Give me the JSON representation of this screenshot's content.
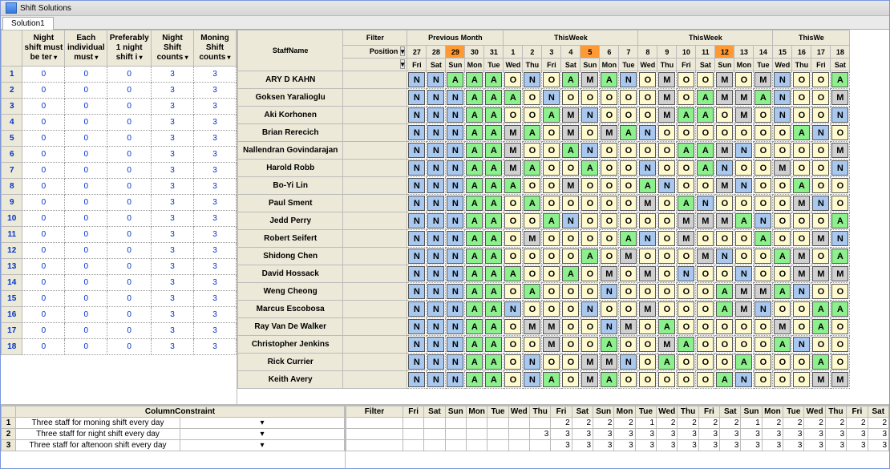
{
  "window": {
    "title": "Shift Solutions",
    "tab": "Solution1"
  },
  "left": {
    "headers": [
      "Night shift must be ter",
      "Each individual must",
      "Preferably 1 night shift i",
      "Night Shift counts",
      "Moning Shift counts"
    ],
    "rows": [
      {
        "i": 1,
        "v": [
          0,
          0,
          0,
          3,
          3
        ]
      },
      {
        "i": 2,
        "v": [
          0,
          0,
          0,
          3,
          3
        ]
      },
      {
        "i": 3,
        "v": [
          0,
          0,
          0,
          3,
          3
        ]
      },
      {
        "i": 4,
        "v": [
          0,
          0,
          0,
          3,
          3
        ]
      },
      {
        "i": 5,
        "v": [
          0,
          0,
          0,
          3,
          3
        ]
      },
      {
        "i": 6,
        "v": [
          0,
          0,
          0,
          3,
          3
        ]
      },
      {
        "i": 7,
        "v": [
          0,
          0,
          0,
          3,
          3
        ]
      },
      {
        "i": 8,
        "v": [
          0,
          0,
          0,
          3,
          3
        ]
      },
      {
        "i": 9,
        "v": [
          0,
          0,
          0,
          3,
          3
        ]
      },
      {
        "i": 10,
        "v": [
          0,
          0,
          0,
          3,
          3
        ]
      },
      {
        "i": 11,
        "v": [
          0,
          0,
          0,
          3,
          3
        ]
      },
      {
        "i": 12,
        "v": [
          0,
          0,
          0,
          3,
          3
        ]
      },
      {
        "i": 13,
        "v": [
          0,
          0,
          0,
          3,
          3
        ]
      },
      {
        "i": 14,
        "v": [
          0,
          0,
          0,
          3,
          3
        ]
      },
      {
        "i": 15,
        "v": [
          0,
          0,
          0,
          3,
          3
        ]
      },
      {
        "i": 16,
        "v": [
          0,
          0,
          0,
          3,
          3
        ]
      },
      {
        "i": 17,
        "v": [
          0,
          0,
          0,
          3,
          3
        ]
      },
      {
        "i": 18,
        "v": [
          0,
          0,
          0,
          3,
          3
        ]
      }
    ]
  },
  "sched_header": {
    "filter_label": "Filter",
    "staffname": "StaffName",
    "position": "Position",
    "groups": [
      "Previous Month",
      "ThisWeek",
      "ThisWeek",
      "ThisWe"
    ],
    "days": [
      "27",
      "28",
      "29",
      "30",
      "31",
      "1",
      "2",
      "3",
      "4",
      "5",
      "6",
      "7",
      "8",
      "9",
      "10",
      "11",
      "12",
      "13",
      "14",
      "15",
      "16",
      "17",
      "18"
    ],
    "highlight": [
      2,
      9,
      16
    ],
    "dow": [
      "Fri",
      "Sat",
      "Sun",
      "Mon",
      "Tue",
      "Wed",
      "Thu",
      "Fri",
      "Sat",
      "Sun",
      "Mon",
      "Tue",
      "Wed",
      "Thu",
      "Fri",
      "Sat",
      "Sun",
      "Mon",
      "Tue",
      "Wed",
      "Thu",
      "Fri",
      "Sat"
    ]
  },
  "staff": [
    {
      "name": "ARY D KAHN",
      "codes": [
        "N",
        "N",
        "A",
        "A",
        "A",
        "O",
        "N",
        "O",
        "A",
        "M",
        "A",
        "N",
        "O",
        "M",
        "O",
        "O",
        "M",
        "O",
        "M",
        "N",
        "O",
        "O",
        "A"
      ]
    },
    {
      "name": "Goksen Yaralioglu",
      "codes": [
        "N",
        "N",
        "N",
        "A",
        "A",
        "A",
        "O",
        "N",
        "O",
        "O",
        "O",
        "O",
        "O",
        "M",
        "O",
        "A",
        "M",
        "M",
        "A",
        "N",
        "O",
        "O",
        "M"
      ]
    },
    {
      "name": "Aki Korhonen",
      "codes": [
        "N",
        "N",
        "N",
        "A",
        "A",
        "O",
        "O",
        "A",
        "M",
        "N",
        "O",
        "O",
        "O",
        "M",
        "A",
        "A",
        "O",
        "M",
        "O",
        "N",
        "O",
        "O",
        "N"
      ]
    },
    {
      "name": "Brian Rerecich",
      "codes": [
        "N",
        "N",
        "N",
        "A",
        "A",
        "M",
        "A",
        "O",
        "M",
        "O",
        "M",
        "A",
        "N",
        "O",
        "O",
        "O",
        "O",
        "O",
        "O",
        "O",
        "A",
        "N",
        "O"
      ]
    },
    {
      "name": "Nallendran Govindarajan",
      "codes": [
        "N",
        "N",
        "N",
        "A",
        "A",
        "M",
        "O",
        "O",
        "A",
        "N",
        "O",
        "O",
        "O",
        "O",
        "A",
        "A",
        "M",
        "N",
        "O",
        "O",
        "O",
        "O",
        "M"
      ]
    },
    {
      "name": "Harold Robb",
      "codes": [
        "N",
        "N",
        "N",
        "A",
        "A",
        "M",
        "A",
        "O",
        "O",
        "A",
        "O",
        "O",
        "N",
        "O",
        "O",
        "A",
        "N",
        "O",
        "O",
        "M",
        "O",
        "O",
        "N"
      ]
    },
    {
      "name": "Bo-Yi Lin",
      "codes": [
        "N",
        "N",
        "N",
        "A",
        "A",
        "A",
        "O",
        "O",
        "M",
        "O",
        "O",
        "O",
        "A",
        "N",
        "O",
        "O",
        "M",
        "N",
        "O",
        "O",
        "A",
        "O",
        "O"
      ]
    },
    {
      "name": "Paul Sment",
      "codes": [
        "N",
        "N",
        "N",
        "A",
        "A",
        "O",
        "A",
        "O",
        "O",
        "O",
        "O",
        "O",
        "M",
        "O",
        "A",
        "N",
        "O",
        "O",
        "O",
        "O",
        "M",
        "N",
        "O"
      ]
    },
    {
      "name": "Jedd Perry",
      "codes": [
        "N",
        "N",
        "N",
        "A",
        "A",
        "O",
        "O",
        "A",
        "N",
        "O",
        "O",
        "O",
        "O",
        "O",
        "M",
        "M",
        "M",
        "A",
        "N",
        "O",
        "O",
        "O",
        "A"
      ]
    },
    {
      "name": "Robert Seifert",
      "codes": [
        "N",
        "N",
        "N",
        "A",
        "A",
        "O",
        "M",
        "O",
        "O",
        "O",
        "O",
        "A",
        "N",
        "O",
        "M",
        "O",
        "O",
        "O",
        "A",
        "O",
        "O",
        "M",
        "N"
      ]
    },
    {
      "name": "Shidong Chen",
      "codes": [
        "N",
        "N",
        "N",
        "A",
        "A",
        "O",
        "O",
        "O",
        "O",
        "A",
        "O",
        "M",
        "O",
        "O",
        "O",
        "M",
        "N",
        "O",
        "O",
        "A",
        "M",
        "O",
        "A"
      ]
    },
    {
      "name": "David Hossack",
      "codes": [
        "N",
        "N",
        "N",
        "A",
        "A",
        "A",
        "O",
        "O",
        "A",
        "O",
        "M",
        "O",
        "M",
        "O",
        "N",
        "O",
        "O",
        "N",
        "O",
        "O",
        "M",
        "M",
        "M"
      ]
    },
    {
      "name": "Weng Cheong",
      "codes": [
        "N",
        "N",
        "N",
        "A",
        "A",
        "O",
        "A",
        "O",
        "O",
        "O",
        "N",
        "O",
        "O",
        "O",
        "O",
        "O",
        "A",
        "M",
        "M",
        "A",
        "N",
        "O",
        "O"
      ]
    },
    {
      "name": "Marcus Escobosa",
      "codes": [
        "N",
        "N",
        "N",
        "A",
        "A",
        "N",
        "O",
        "O",
        "O",
        "N",
        "O",
        "O",
        "M",
        "O",
        "O",
        "O",
        "A",
        "M",
        "N",
        "O",
        "O",
        "A",
        "A"
      ]
    },
    {
      "name": "Ray Van De Walker",
      "codes": [
        "N",
        "N",
        "N",
        "A",
        "A",
        "O",
        "M",
        "M",
        "O",
        "O",
        "N",
        "M",
        "O",
        "A",
        "O",
        "O",
        "O",
        "O",
        "O",
        "M",
        "O",
        "A",
        "O"
      ]
    },
    {
      "name": "Christopher Jenkins",
      "codes": [
        "N",
        "N",
        "N",
        "A",
        "A",
        "O",
        "O",
        "M",
        "O",
        "O",
        "A",
        "O",
        "O",
        "M",
        "A",
        "O",
        "O",
        "O",
        "O",
        "A",
        "N",
        "O",
        "O"
      ]
    },
    {
      "name": "Rick Currier",
      "codes": [
        "N",
        "N",
        "N",
        "A",
        "A",
        "O",
        "N",
        "O",
        "O",
        "M",
        "M",
        "N",
        "O",
        "A",
        "O",
        "O",
        "O",
        "A",
        "O",
        "O",
        "O",
        "A",
        "O"
      ]
    },
    {
      "name": "Keith Avery",
      "codes": [
        "N",
        "N",
        "N",
        "A",
        "A",
        "O",
        "N",
        "A",
        "O",
        "M",
        "A",
        "O",
        "O",
        "O",
        "O",
        "O",
        "A",
        "N",
        "O",
        "O",
        "O",
        "M",
        "M"
      ]
    }
  ],
  "lower": {
    "constraint_header": "ColumnConstraint",
    "filter_header": "Filter",
    "dow": [
      "Fri",
      "Sat",
      "Sun",
      "Mon",
      "Tue",
      "Wed",
      "Thu",
      "Fri",
      "Sat",
      "Sun",
      "Mon",
      "Tue",
      "Wed",
      "Thu",
      "Fri",
      "Sat",
      "Sun",
      "Mon",
      "Tue",
      "Wed",
      "Thu",
      "Fri",
      "Sat"
    ],
    "rows": [
      {
        "i": 1,
        "label": "Three staff for moning shift every day",
        "vals": [
          "",
          "",
          "",
          "",
          "",
          "",
          "",
          "2",
          "2",
          "2",
          "2",
          "1",
          "2",
          "2",
          "2",
          "2",
          "1",
          "2",
          "2",
          "2",
          "2",
          "2",
          "2"
        ]
      },
      {
        "i": 2,
        "label": "Three staff for night shift every day",
        "vals": [
          "",
          "",
          "",
          "",
          "",
          "",
          "3",
          "3",
          "3",
          "3",
          "3",
          "3",
          "3",
          "3",
          "3",
          "3",
          "3",
          "3",
          "3",
          "3",
          "3",
          "3",
          "3"
        ]
      },
      {
        "i": 3,
        "label": "Three staff for aftenoon shift every day",
        "vals": [
          "",
          "",
          "",
          "",
          "",
          "",
          "",
          "3",
          "3",
          "3",
          "3",
          "3",
          "3",
          "3",
          "3",
          "3",
          "3",
          "3",
          "3",
          "3",
          "3",
          "3",
          "3"
        ]
      }
    ]
  }
}
